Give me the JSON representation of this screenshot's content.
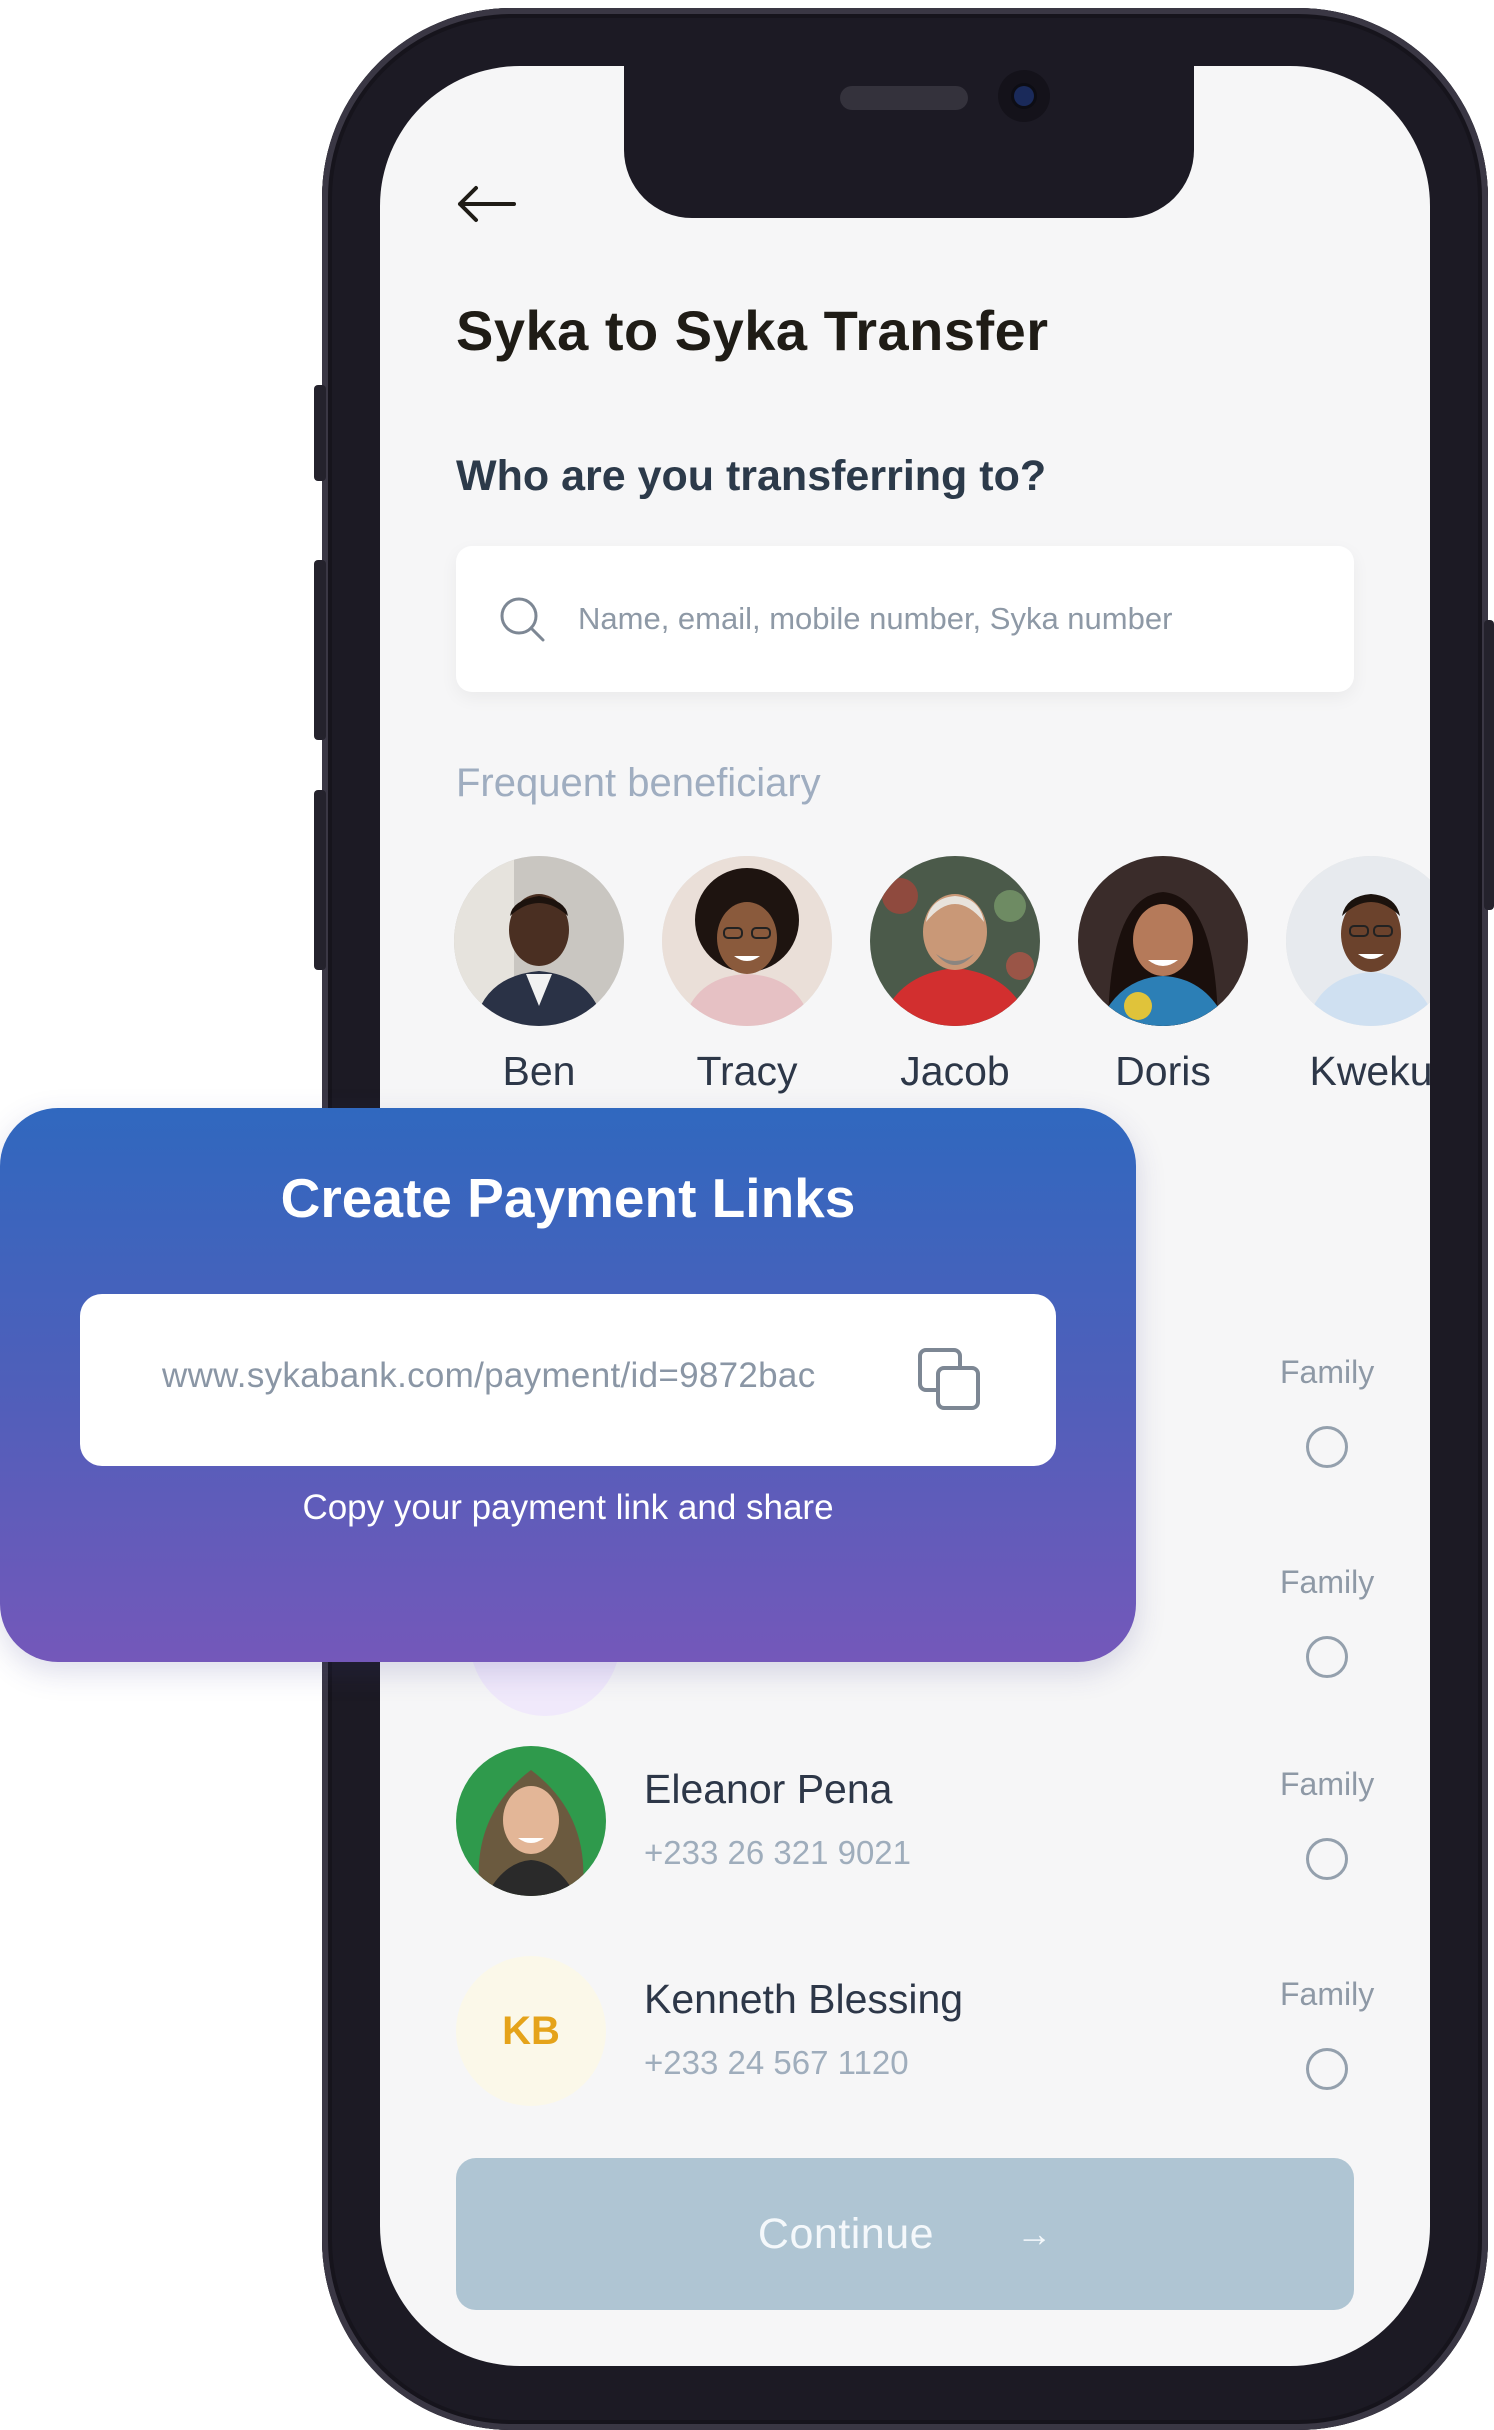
{
  "screen": {
    "title": "Syka to Syka Transfer",
    "subtitle": "Who are you transferring to?",
    "search": {
      "placeholder": "Name, email, mobile number, Syka number",
      "value": ""
    },
    "frequent_label": "Frequent beneficiary",
    "beneficiaries": [
      {
        "name": "Ben"
      },
      {
        "name": "Tracy"
      },
      {
        "name": "Jacob"
      },
      {
        "name": "Doris"
      },
      {
        "name": "Kweku"
      }
    ],
    "contacts": [
      {
        "name": "",
        "phone": "",
        "tag": "Family",
        "selected": false
      },
      {
        "name": "",
        "phone": "",
        "tag": "Family",
        "selected": false
      },
      {
        "name": "Eleanor Pena",
        "phone": "+233 26 321 9021",
        "tag": "Family",
        "selected": false
      },
      {
        "name": "Kenneth Blessing",
        "phone": "+233 24 567 1120",
        "tag": "Family",
        "initials": "KB",
        "selected": false
      }
    ],
    "continue_label": "Continue",
    "continue_arrow": "→"
  },
  "payment_card": {
    "title": "Create Payment Links",
    "link": "www.sykabank.com/payment/id=9872bac",
    "caption": "Copy your payment link and share"
  },
  "colors": {
    "card_gradient_top": "#3068bf",
    "card_gradient_bottom": "#7458ba",
    "continue_button": "#afc5d3",
    "initials_text": "#e5a31a",
    "section_label": "#9fadc0"
  },
  "icons": [
    "back-arrow-icon",
    "search-icon",
    "copy-icon",
    "arrow-right-icon"
  ]
}
